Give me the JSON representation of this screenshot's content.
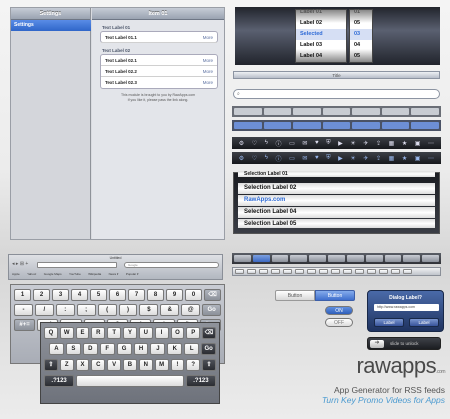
{
  "ipad": {
    "master_title": "Settings",
    "master_selected": "Settings",
    "detail_title": "Item 01",
    "section1_header": "Text Label 01",
    "section1_rows": [
      {
        "label": "Text Label 01.1",
        "action": "More"
      }
    ],
    "section2_header": "Text Label 02",
    "section2_rows": [
      {
        "label": "Text Label 02.1",
        "action": "More"
      },
      {
        "label": "Text Label 02.2",
        "action": "More"
      },
      {
        "label": "Text Label 02.3",
        "action": "More"
      }
    ],
    "footer_line1": "This module is brought to you by RawApps.com",
    "footer_line2": "If you like it, please pass the link along."
  },
  "picker": {
    "col1": [
      "Label 01",
      "Label 02",
      "Selected",
      "Label 03",
      "Label 04",
      "Label 05"
    ],
    "col2": [
      "01",
      "05",
      "03",
      "04",
      "05"
    ]
  },
  "title_bar": {
    "title": "Title"
  },
  "search": {
    "icon": "magnifier"
  },
  "selection_list": {
    "items": [
      "Selection Label 02",
      "RawApps.com",
      "Selection Label 04",
      "Selection Label 05"
    ],
    "partial_top": "Selection Label 01"
  },
  "browser": {
    "title": "Untitled",
    "url_placeholder": "Google",
    "bookmarks": [
      "Apple",
      "Yahoo!",
      "Google Maps",
      "YouTube",
      "Wikipedia",
      "News ▾",
      "Popular ▾"
    ]
  },
  "keyboard_light": {
    "row1": [
      "1",
      "2",
      "3",
      "4",
      "5",
      "6",
      "7",
      "8",
      "9",
      "0",
      "⌫"
    ],
    "row2": [
      "-",
      "/",
      ":",
      ";",
      "(",
      ")",
      "$",
      "&",
      "@",
      "Go"
    ],
    "row3": [
      "#+=",
      "undo",
      ".",
      ",",
      "?",
      "!",
      "'",
      "\"",
      "#+="
    ],
    "row4": [
      "ABC",
      "",
      "ABC"
    ]
  },
  "keyboard_dark": {
    "row1": [
      "Q",
      "W",
      "E",
      "R",
      "T",
      "Y",
      "U",
      "I",
      "O",
      "P",
      "⌫"
    ],
    "row2": [
      "A",
      "S",
      "D",
      "F",
      "G",
      "H",
      "J",
      "K",
      "L",
      "Go"
    ],
    "row3": [
      "⇧",
      "Z",
      "X",
      "C",
      "V",
      "B",
      "N",
      "M",
      "!",
      "?",
      "⇧"
    ],
    "row4": [
      ".?123",
      "",
      ".?123"
    ]
  },
  "seg_button": {
    "left": "Button",
    "right": "Button"
  },
  "toggles": {
    "on": "ON",
    "off": "OFF"
  },
  "dialog": {
    "title": "Dialog Label?",
    "text": "http://www.rawapps.com",
    "btn1": "Label",
    "btn2": "Label"
  },
  "unlock": {
    "label": "slide to unlock"
  },
  "logo": {
    "brand_prefix": "raw",
    "brand_suffix": "apps",
    "brand_tld": ".com",
    "tagline1": "App Generator for RSS feeds",
    "tagline2": "Turn Key Promo Videos for Apps"
  },
  "colors": {
    "accent": "#3b6fd4",
    "tagline2": "#4a9ad0"
  }
}
